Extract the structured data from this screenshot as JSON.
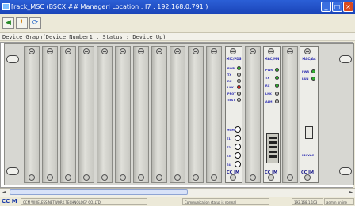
{
  "window": {
    "title": "[rack_MSC (BSCX ## Managerl Location :  I7 : 192.168.0.791 )",
    "min_symbol": "_",
    "max_symbol": "□",
    "close_symbol": "×"
  },
  "toolbar": {
    "btn1_glyph": "◀",
    "btn2_glyph": "!",
    "btn3_glyph": "⟳"
  },
  "device_status_text": "Device Graph(Device Number1 , Status : Device Up)",
  "rack": {
    "empty_slot_count": 11,
    "card1": {
      "title": "MIC/PDS",
      "leds": [
        {
          "label": "PWR",
          "color": "#2fb52f"
        },
        {
          "label": "TX",
          "color": "#bfbfbf"
        },
        {
          "label": "RX",
          "color": "#bfbfbf"
        },
        {
          "label": "LNK",
          "color": "#e02020"
        },
        {
          "label": "PROT",
          "color": "#bfbfbf"
        },
        {
          "label": "TEST",
          "color": "#bfbfbf"
        }
      ],
      "ports": [
        "MGMT",
        "E1",
        "E2",
        "E3",
        "E4"
      ],
      "footer": "CC IM"
    },
    "card2": {
      "title": "MAC/MN",
      "leds": [
        {
          "label": "PWR",
          "color": "#2fb52f"
        },
        {
          "label": "TX",
          "color": "#2fb52f"
        },
        {
          "label": "RX",
          "color": "#2fb52f"
        },
        {
          "label": "LNK",
          "color": "#bfbfbf"
        },
        {
          "label": "ALM",
          "color": "#bfbfbf"
        }
      ],
      "footer": "CC IM"
    },
    "card3": {
      "title": "MAC/A4",
      "leds": [
        {
          "label": "PWR",
          "color": "#2fb52f"
        },
        {
          "label": "RUN",
          "color": "#2fb52f"
        }
      ],
      "sub_label": "220VAC",
      "footer": "CC IM"
    }
  },
  "scrollbar": {
    "left_arrow": "◄",
    "right_arrow": "►"
  },
  "statusbar": {
    "logo": "CC M",
    "segment1": "CCM WIRELESS NETWORK TECHNOLOGY CO.,LTD",
    "segment2": "Communication status is normal",
    "segment3": "192.168.1.103",
    "segment4": "admin online"
  }
}
